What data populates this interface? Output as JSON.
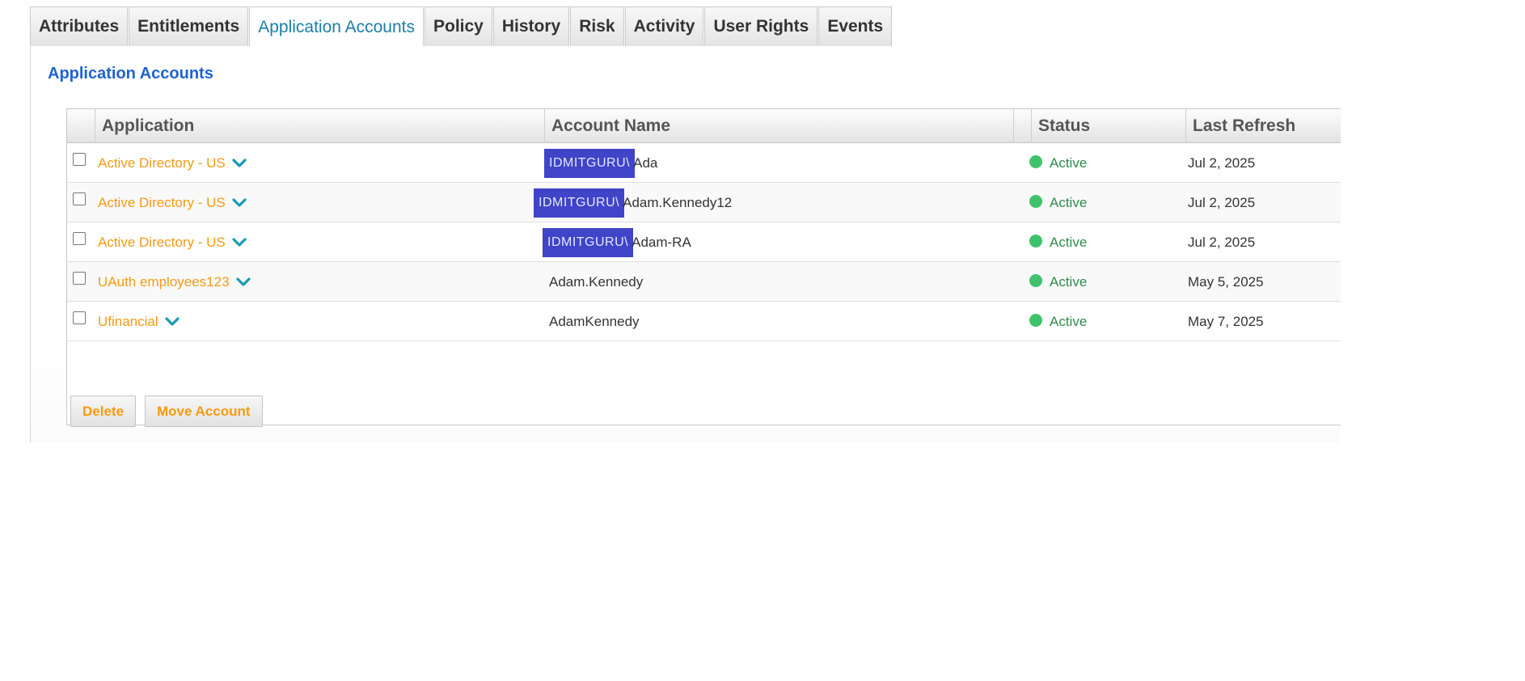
{
  "tabs": [
    {
      "label": "Attributes"
    },
    {
      "label": "Entitlements"
    },
    {
      "label": "Application Accounts"
    },
    {
      "label": "Policy"
    },
    {
      "label": "History"
    },
    {
      "label": "Risk"
    },
    {
      "label": "Activity"
    },
    {
      "label": "User Rights"
    },
    {
      "label": "Events"
    }
  ],
  "active_tab": "Application Accounts",
  "section_title": "Application Accounts",
  "columns": {
    "application": "Application",
    "account_name": "Account Name",
    "status": "Status",
    "last_refresh": "Last Refresh"
  },
  "rows": [
    {
      "application": "Active Directory - US",
      "redacted": "IDMITGURU\\",
      "account_suffix": "Ada",
      "status": "Active",
      "last_refresh": "Jul 2, 2025"
    },
    {
      "application": "Active Directory - US",
      "redacted": "IDMITGURU\\",
      "account_suffix": "Adam.Kennedy12",
      "status": "Active",
      "last_refresh": "Jul 2, 2025"
    },
    {
      "application": "Active Directory - US",
      "redacted": "IDMITGURU\\",
      "account_suffix": "Adam-RA",
      "status": "Active",
      "last_refresh": "Jul 2, 2025"
    },
    {
      "application": "UAuth employees123",
      "redacted": "",
      "account_suffix": "Adam.Kennedy",
      "status": "Active",
      "last_refresh": "May 5, 2025"
    },
    {
      "application": "Ufinancial",
      "redacted": "",
      "account_suffix": "AdamKennedy",
      "status": "Active",
      "last_refresh": "May 7, 2025"
    }
  ],
  "buttons": {
    "delete": "Delete",
    "move_account": "Move Account"
  },
  "colors": {
    "tab_active_text": "#1a7fa8",
    "section_title": "#1f62d1",
    "application_link": "#f59a12",
    "status_active": "#3ec36b",
    "redaction_block": "#3f44c8"
  },
  "icons": {
    "row_expand": "chevron-down-icon",
    "status": "status-dot-icon"
  }
}
